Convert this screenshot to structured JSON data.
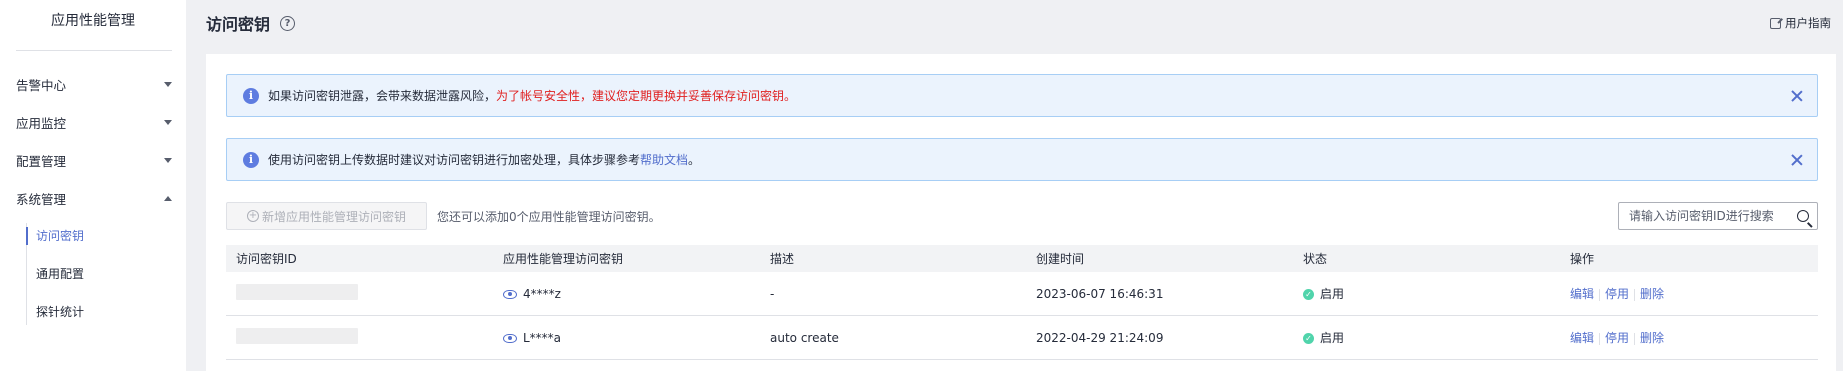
{
  "sidebar": {
    "app_title": "应用性能管理",
    "menu": [
      {
        "label": "告警中心",
        "expanded": false
      },
      {
        "label": "应用监控",
        "expanded": false
      },
      {
        "label": "配置管理",
        "expanded": false
      },
      {
        "label": "系统管理",
        "expanded": true
      }
    ],
    "submenu": [
      {
        "label": "访问密钥",
        "active": true
      },
      {
        "label": "通用配置",
        "active": false
      },
      {
        "label": "探针统计",
        "active": false
      }
    ]
  },
  "header": {
    "title": "访问密钥",
    "help_glyph": "?",
    "guide_label": "用户指南"
  },
  "alerts": [
    {
      "text_plain": "如果访问密钥泄露，会带来数据泄露风险，",
      "text_red": "为了帐号安全性，建议您定期更换并妥善保存访问密钥。"
    },
    {
      "text_plain": "使用访问密钥上传数据时建议对访问密钥进行加密处理，具体步骤参考",
      "link_text": "帮助文档",
      "text_end": "。"
    }
  ],
  "toolbar": {
    "add_button_label": "新增应用性能管理访问密钥",
    "hint": "您还可以添加0个应用性能管理访问密钥。",
    "search_placeholder": "请输入访问密钥ID进行搜索"
  },
  "table": {
    "columns": [
      "访问密钥ID",
      "应用性能管理访问密钥",
      "描述",
      "创建时间",
      "状态",
      "操作"
    ],
    "rows": [
      {
        "secret": "4****z",
        "description": "-",
        "created": "2023-06-07 16:46:31",
        "status": "启用"
      },
      {
        "secret": "L****a",
        "description": "auto create",
        "created": "2022-04-29 21:24:09",
        "status": "启用"
      }
    ],
    "actions": [
      "编辑",
      "停用",
      "删除"
    ]
  },
  "colors": {
    "accent": "#526ecc",
    "warning_text": "#e02020",
    "status_ok": "#50d4ab",
    "alert_bg": "#ebf3fd"
  }
}
